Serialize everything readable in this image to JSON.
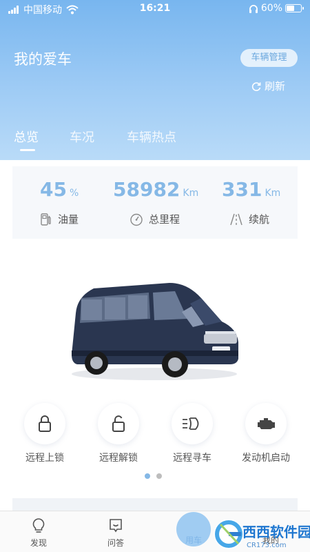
{
  "status_bar": {
    "carrier": "中国移动",
    "time": "16:21",
    "battery": "60%",
    "battery_level": 0.6
  },
  "header": {
    "title": "我的爱车",
    "manage_button": "车辆管理",
    "refresh": "刷新"
  },
  "tabs": [
    {
      "label": "总览",
      "active": true
    },
    {
      "label": "车况",
      "active": false
    },
    {
      "label": "车辆热点",
      "active": false
    }
  ],
  "stats": {
    "fuel": {
      "value": "45",
      "unit": "%",
      "label": "油量",
      "icon": "fuel-pump-icon"
    },
    "mileage": {
      "value": "58982",
      "unit": "Km",
      "label": "总里程",
      "icon": "odometer-icon"
    },
    "range": {
      "value": "331",
      "unit": "Km",
      "label": "续航",
      "icon": "road-icon"
    }
  },
  "vehicle": {
    "image": "van-image",
    "color": "#2a3650"
  },
  "actions": [
    {
      "label": "远程上锁",
      "icon": "lock-icon"
    },
    {
      "label": "远程解锁",
      "icon": "unlock-icon"
    },
    {
      "label": "远程寻车",
      "icon": "headlight-icon"
    },
    {
      "label": "发动机启动",
      "icon": "engine-icon"
    }
  ],
  "pager": {
    "pages": 2,
    "current": 1
  },
  "bottom_nav": [
    {
      "label": "发现",
      "icon": "bulb-icon",
      "active": false
    },
    {
      "label": "问答",
      "icon": "chat-icon",
      "active": false
    },
    {
      "label": "用车",
      "icon": "car-icon",
      "active": true
    },
    {
      "label": "我的",
      "icon": "user-icon",
      "active": false
    }
  ],
  "watermark": {
    "text": "西西软件园",
    "subtext": "CR173.com"
  },
  "colors": {
    "accent": "#85b8e6",
    "header_top": "#78b6ef",
    "header_bottom": "#b9dbf8"
  }
}
